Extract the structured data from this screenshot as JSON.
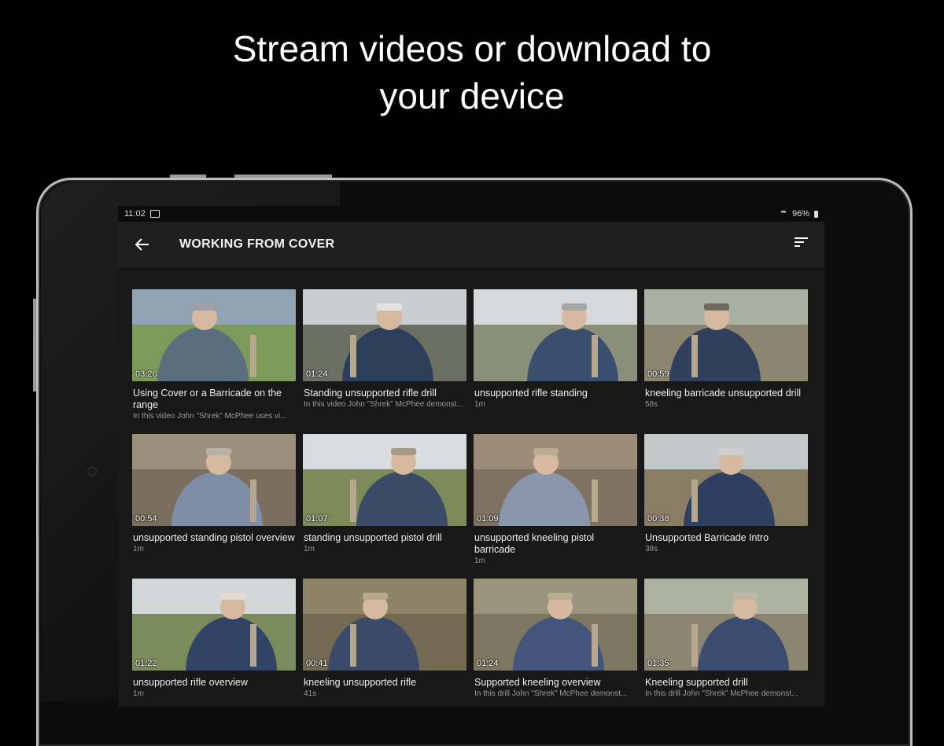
{
  "promo": {
    "line1": "Stream videos or download to",
    "line2": "your device"
  },
  "status": {
    "time": "11:02",
    "battery": "96%"
  },
  "appbar": {
    "title": "WORKING FROM COVER",
    "back_icon": "arrow-back-icon",
    "sort_icon": "sort-icon"
  },
  "videos": [
    {
      "title": "Using Cover or a Barricade on the range",
      "subtitle": "In this video John \"Shrek\" McPhee uses vi...",
      "duration": "03:26"
    },
    {
      "title": "Standing unsupported rifle drill",
      "subtitle": "In this video John \"Shrek\" McPhee demonst...",
      "duration": "01:24"
    },
    {
      "title": "unsupported rifle standing",
      "subtitle": "1m",
      "duration": ""
    },
    {
      "title": "kneeling barricade unsupported drill",
      "subtitle": "58s",
      "duration": "00:59"
    },
    {
      "title": "unsupported standing pistol overview",
      "subtitle": "1m",
      "duration": "00:54"
    },
    {
      "title": "standing unsupported pistol drill",
      "subtitle": "1m",
      "duration": "01:07"
    },
    {
      "title": "unsupported kneeling pistol barricade",
      "subtitle": "1m",
      "duration": "01:09"
    },
    {
      "title": "Unsupported Barricade Intro",
      "subtitle": "38s",
      "duration": "00:38"
    },
    {
      "title": "unsupported rifle overview",
      "subtitle": "1m",
      "duration": "01:22"
    },
    {
      "title": "kneeling unsupported rifle",
      "subtitle": "41s",
      "duration": "00:41"
    },
    {
      "title": "Supported kneeling overview",
      "subtitle": "In this drill John \"Shrek\" McPhee demonst...",
      "duration": "01:24"
    },
    {
      "title": "Kneeling supported drill",
      "subtitle": "In this drill John \"Shrek\" McPhee demonst...",
      "duration": "01:35"
    }
  ],
  "colors": {
    "background": "#000000",
    "screen": "#181818",
    "appbar": "#1f1f1f"
  }
}
